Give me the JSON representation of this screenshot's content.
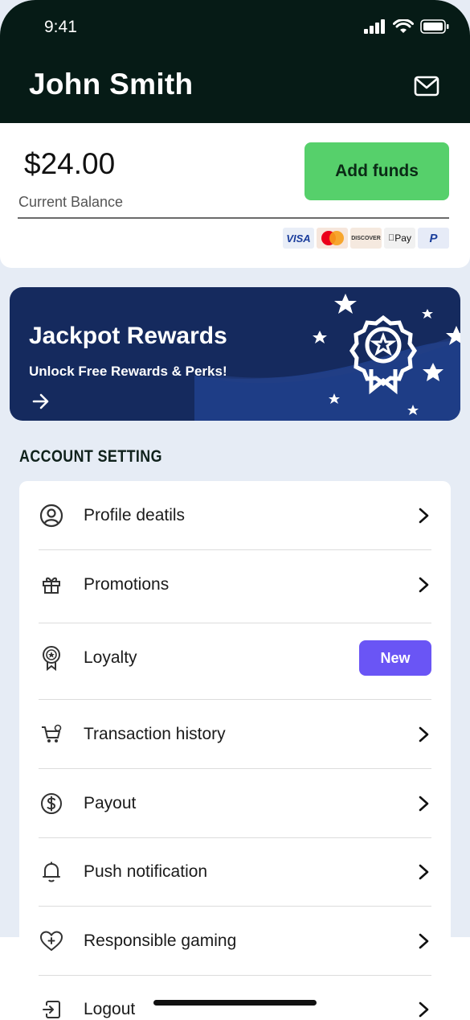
{
  "status": {
    "time": "9:41"
  },
  "header": {
    "user_name": "John Smith"
  },
  "balance": {
    "amount": "$24.00",
    "label": "Current Balance",
    "add_funds_label": "Add funds",
    "payment_methods": [
      "VISA",
      "Mastercard",
      "DISCOVER",
      "Apple Pay",
      "PayPal"
    ]
  },
  "rewards": {
    "title": "Jackpot Rewards",
    "subtitle": "Unlock Free Rewards & Perks!"
  },
  "account": {
    "section_title": "ACCOUNT SETTING",
    "items": [
      {
        "label": "Profile deatils",
        "icon": "user-circle-icon"
      },
      {
        "label": "Promotions",
        "icon": "gift-icon"
      },
      {
        "label": "Loyalty",
        "icon": "award-icon",
        "badge": "New"
      },
      {
        "label": "Transaction history",
        "icon": "cart-icon"
      },
      {
        "label": "Payout",
        "icon": "dollar-circle-icon"
      },
      {
        "label": "Push notification",
        "icon": "bell-icon"
      },
      {
        "label": "Responsible gaming",
        "icon": "heart-icon"
      },
      {
        "label": "Logout",
        "icon": "logout-icon"
      }
    ]
  },
  "colors": {
    "header_bg": "#061b16",
    "accent_green": "#56d06b",
    "rewards_bg": "#152a5e",
    "badge_purple": "#6a55f5",
    "page_bg": "#e6ecf5"
  }
}
